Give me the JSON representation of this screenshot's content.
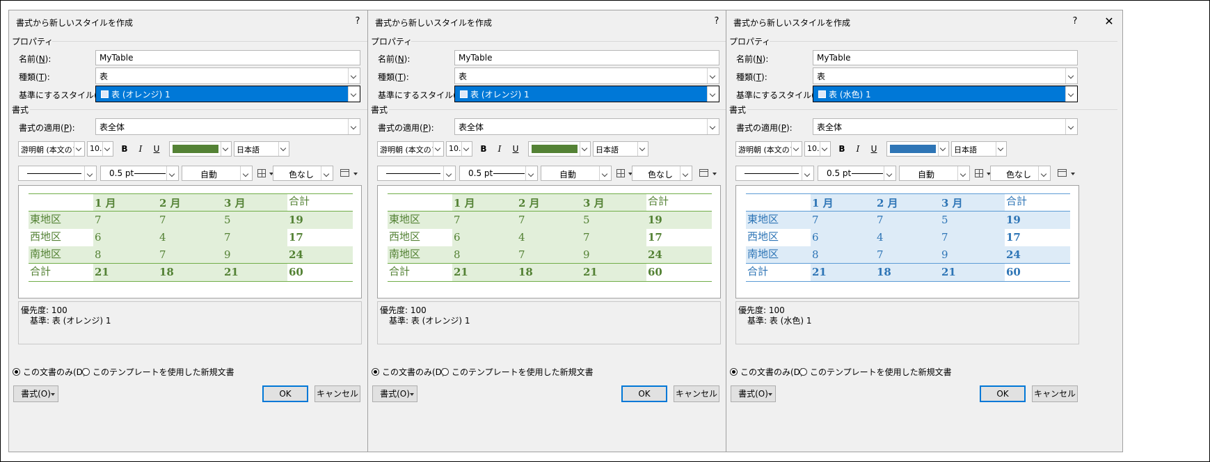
{
  "dialogs": [
    {
      "title": "書式から新しいスタイルを作成",
      "help": "?",
      "close": "✕",
      "properties_section": "プロパティ",
      "name_label": "名前(",
      "name_key": "N",
      "name_value": "MyTable",
      "type_label": "種類(",
      "type_key": "T",
      "type_value": "表",
      "base_label": "基準にするスタイル(",
      "base_key": "B",
      "base_value": "表 (オレンジ)  1",
      "format_section": "書式",
      "apply_label": "書式の適用(",
      "apply_key": "P",
      "apply_value": "表全体",
      "font_value": "游明朝 (本文のフォント",
      "size_value": "10.5",
      "bold": "B",
      "italic": "I",
      "underline": "U",
      "font_color": "#548235",
      "lang_value": "日本語",
      "border_width": "0.5 pt",
      "border_color": "自動",
      "shading": "色なし",
      "preview": {
        "header": [
          "",
          "1 月",
          "2 月",
          "3 月",
          "合計"
        ],
        "rows": [
          [
            "東地区",
            "7",
            "7",
            "5",
            "19"
          ],
          [
            "西地区",
            "6",
            "4",
            "7",
            "17"
          ],
          [
            "南地区",
            "8",
            "7",
            "9",
            "24"
          ],
          [
            "合計",
            "21",
            "18",
            "21",
            "60"
          ]
        ],
        "text_color": "#548235",
        "band_color": "#e2efda",
        "line_color": "#70ad47"
      },
      "desc_line1": "優先度: 100",
      "desc_line2": "基準: 表 (オレンジ)  1",
      "radio1": "この文書のみ(D)",
      "radio2": "このテンプレートを使用した新規文書",
      "format_btn": "書式(O)",
      "ok": "OK",
      "cancel": "キャンセル"
    },
    {
      "title": "書式から新しいスタイルを作成",
      "help": "?",
      "close": "✕",
      "properties_section": "プロパティ",
      "name_label": "名前(",
      "name_key": "N",
      "name_value": "MyTable",
      "type_label": "種類(",
      "type_key": "T",
      "type_value": "表",
      "base_label": "基準にするスタイル(",
      "base_key": "B",
      "base_value": "表 (オレンジ)  1",
      "format_section": "書式",
      "apply_label": "書式の適用(",
      "apply_key": "P",
      "apply_value": "表全体",
      "font_value": "游明朝 (本文のフォント",
      "size_value": "10.5",
      "bold": "B",
      "italic": "I",
      "underline": "U",
      "font_color": "#548235",
      "lang_value": "日本語",
      "border_width": "0.5 pt",
      "border_color": "自動",
      "shading": "色なし",
      "preview": {
        "header": [
          "",
          "1 月",
          "2 月",
          "3 月",
          "合計"
        ],
        "rows": [
          [
            "東地区",
            "7",
            "7",
            "5",
            "19"
          ],
          [
            "西地区",
            "6",
            "4",
            "7",
            "17"
          ],
          [
            "南地区",
            "8",
            "7",
            "9",
            "24"
          ],
          [
            "合計",
            "21",
            "18",
            "21",
            "60"
          ]
        ],
        "text_color": "#548235",
        "band_color": "#e2efda",
        "line_color": "#70ad47"
      },
      "desc_line1": "優先度: 100",
      "desc_line2": "基準: 表 (オレンジ)  1",
      "radio1": "この文書のみ(D)",
      "radio2": "このテンプレートを使用した新規文書",
      "format_btn": "書式(O)",
      "ok": "OK",
      "cancel": "キャンセル"
    },
    {
      "title": "書式から新しいスタイルを作成",
      "help": "?",
      "close": "✕",
      "properties_section": "プロパティ",
      "name_label": "名前(",
      "name_key": "N",
      "name_value": "MyTable",
      "type_label": "種類(",
      "type_key": "T",
      "type_value": "表",
      "base_label": "基準にするスタイル(",
      "base_key": "B",
      "base_value": "表 (水色)  1",
      "format_section": "書式",
      "apply_label": "書式の適用(",
      "apply_key": "P",
      "apply_value": "表全体",
      "font_value": "游明朝 (本文のフォント",
      "size_value": "10.5",
      "bold": "B",
      "italic": "I",
      "underline": "U",
      "font_color": "#2e75b6",
      "lang_value": "日本語",
      "border_width": "0.5 pt",
      "border_color": "自動",
      "shading": "色なし",
      "preview": {
        "header": [
          "",
          "1 月",
          "2 月",
          "3 月",
          "合計"
        ],
        "rows": [
          [
            "東地区",
            "7",
            "7",
            "5",
            "19"
          ],
          [
            "西地区",
            "6",
            "4",
            "7",
            "17"
          ],
          [
            "南地区",
            "8",
            "7",
            "9",
            "24"
          ],
          [
            "合計",
            "21",
            "18",
            "21",
            "60"
          ]
        ],
        "text_color": "#2e75b6",
        "band_color": "#ddebf7",
        "line_color": "#5b9bd5"
      },
      "desc_line1": "優先度: 100",
      "desc_line2": "基準: 表 (水色)  1",
      "radio1": "この文書のみ(D)",
      "radio2": "このテンプレートを使用した新規文書",
      "format_btn": "書式(O)",
      "ok": "OK",
      "cancel": "キャンセル"
    }
  ]
}
